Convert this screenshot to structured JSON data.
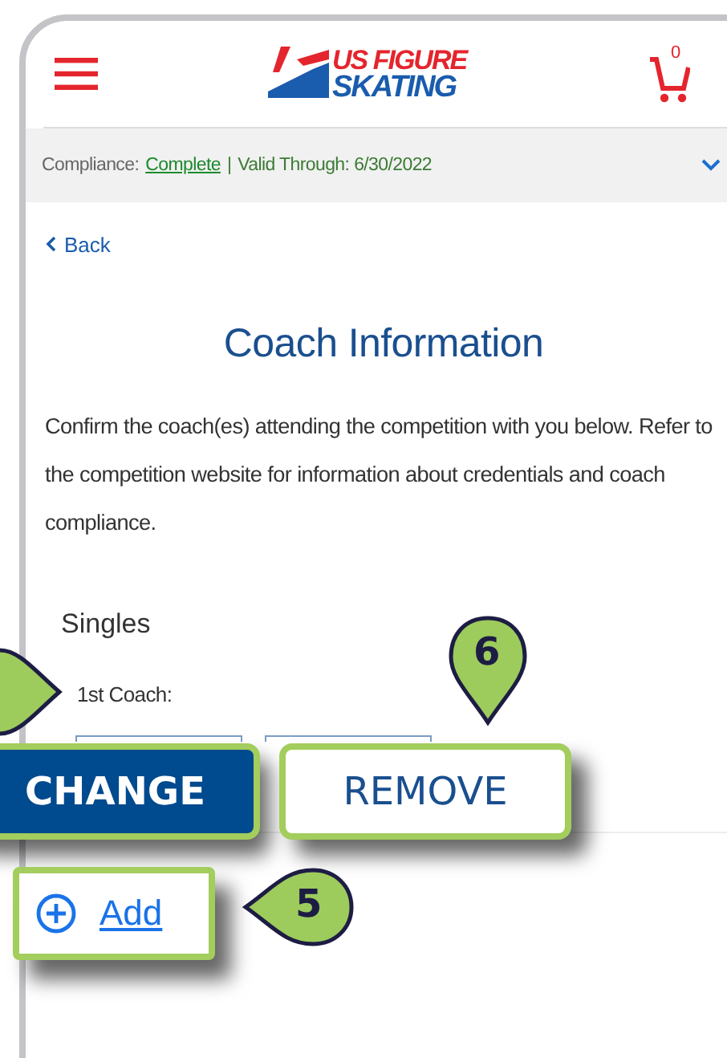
{
  "header": {
    "logo": {
      "line_1": "US FIGURE",
      "line_2": "SKATING"
    },
    "cart_count": "0"
  },
  "compliance_bar": {
    "label": "Compliance:",
    "status_link": "Complete",
    "separator": "|",
    "valid_through": "Valid Through: 6/30/2022"
  },
  "back_link": "Back",
  "title": "Coach Information",
  "intro": "Confirm the coach(es) attending the competition with you below. Refer to the competition website for information about credentials and coach compliance.",
  "section": {
    "heading": "Singles",
    "coach_label": "1st Coach:"
  },
  "zoomed_controls": {
    "change": "CHANGE",
    "remove": "REMOVE",
    "add": "Add"
  },
  "callouts": [
    {
      "number": "6",
      "kind": "down"
    },
    {
      "number": "5",
      "kind": "left"
    }
  ]
}
